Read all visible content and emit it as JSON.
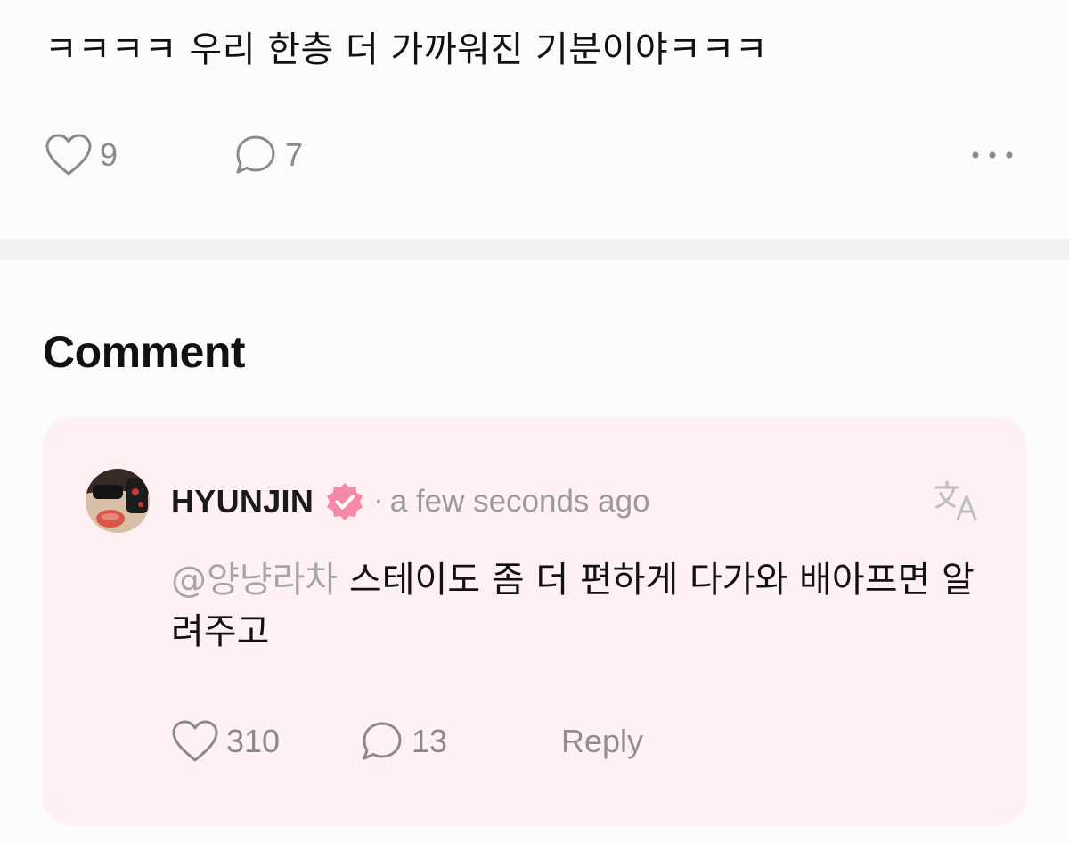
{
  "post": {
    "text": "ㅋㅋㅋㅋ 우리 한층 더 가까워진 기분이야ㅋㅋㅋ",
    "likes": "9",
    "comments": "7",
    "like_icon": "heart-outline-icon",
    "comment_icon": "speech-bubble-icon",
    "more_icon": "more-horizontal-icon"
  },
  "comment_section": {
    "title": "Comment",
    "card_color": "#fff0f3",
    "items": [
      {
        "author": "HYUNJIN",
        "verified_icon": "verified-badge-icon",
        "verified_color": "#f58aa6",
        "separator": "·",
        "time": "a few seconds ago",
        "translate_icon": "translate-icon",
        "mention": "@양냥라차",
        "text": " 스테이도 좀 더 편하게 다가와 배아프면 알려주고",
        "likes": "310",
        "replies": "13",
        "reply_label": "Reply"
      }
    ]
  }
}
